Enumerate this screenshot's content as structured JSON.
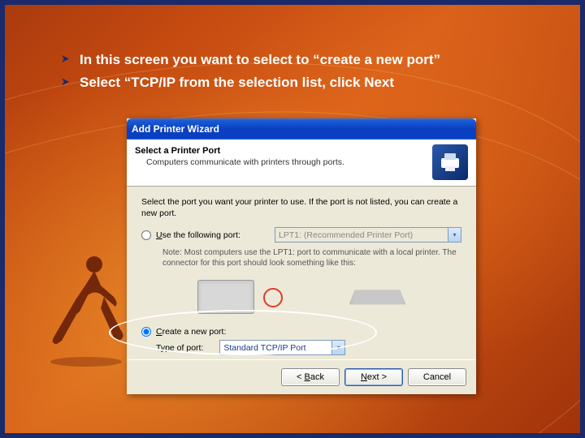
{
  "slide": {
    "bullets": [
      "In this screen you want to select to “create a new port”",
      "Select “TCP/IP from the selection list, click Next"
    ]
  },
  "wizard": {
    "title": "Add Printer Wizard",
    "header": {
      "title": "Select a Printer Port",
      "subtitle": "Computers communicate with printers through ports."
    },
    "instruction": "Select the port you want your printer to use. If the port is not listed, you can create a new port.",
    "option_use_port": {
      "label_pre": "U",
      "label_post": "se the following port:",
      "value": "LPT1: (Recommended Printer Port)"
    },
    "note": "Note: Most computers use the LPT1: port to communicate with a local printer. The connector for this port should look something like this:",
    "option_create_port": {
      "label_pre": "C",
      "label_post": "reate a new port:"
    },
    "type_of_port_label": "Type of port:",
    "type_of_port_value": "Standard TCP/IP Port",
    "buttons": {
      "back": "< Back",
      "next": "Next >",
      "cancel": "Cancel"
    }
  }
}
